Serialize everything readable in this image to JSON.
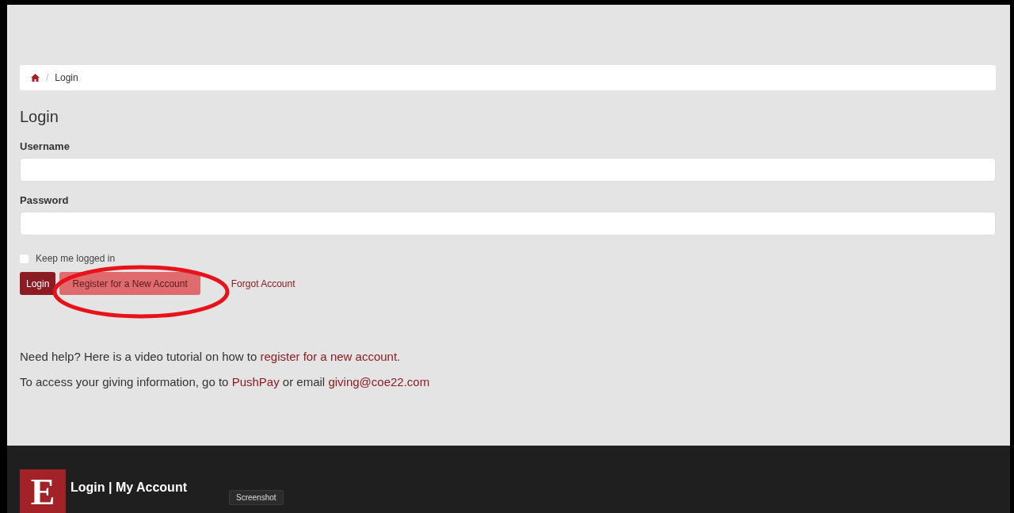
{
  "breadcrumb": {
    "separator": "/",
    "items": [
      "Login"
    ]
  },
  "heading": "Login",
  "fields": [
    {
      "label": "Username"
    },
    {
      "label": "Password"
    }
  ],
  "remember": {
    "label": "Keep me logged in",
    "checked": false
  },
  "buttons": [
    {
      "label": "Login",
      "kind": "primary"
    },
    {
      "label": "Register for a New Account",
      "kind": "secondary"
    },
    {
      "label": "Forgot Account",
      "kind": "link"
    }
  ],
  "help_lines": [
    [
      {
        "text": "Need help? Here is a video tutorial on how to ",
        "kind": "text"
      },
      {
        "text": "register for a new account",
        "kind": "link"
      },
      {
        "text": ".",
        "kind": "text"
      }
    ],
    [
      {
        "text": "To access your giving information, go to ",
        "kind": "text"
      },
      {
        "text": "PushPay",
        "kind": "link"
      },
      {
        "text": " or email ",
        "kind": "text"
      },
      {
        "text": "giving@coe22.com",
        "kind": "link"
      }
    ]
  ],
  "footer": {
    "logo": "E",
    "title": "Login | My Account"
  },
  "tooltip": "Screenshot"
}
